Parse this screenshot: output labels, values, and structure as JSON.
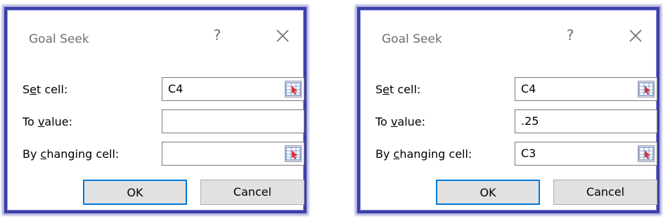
{
  "dialogs": [
    {
      "title": "Goal Seek",
      "help": "?",
      "labels": {
        "set_cell_pre": "S",
        "set_cell_u": "e",
        "set_cell_post": "t cell:",
        "to_value_pre": "To ",
        "to_value_u": "v",
        "to_value_post": "alue:",
        "changing_pre": "By ",
        "changing_u": "c",
        "changing_post": "hanging cell:"
      },
      "set_cell": "C4",
      "to_value": "",
      "changing_cell": "",
      "ok": "OK",
      "cancel": "Cancel"
    },
    {
      "title": "Goal Seek",
      "help": "?",
      "labels": {
        "set_cell_pre": "S",
        "set_cell_u": "e",
        "set_cell_post": "t cell:",
        "to_value_pre": "To ",
        "to_value_u": "v",
        "to_value_post": "alue:",
        "changing_pre": "By ",
        "changing_u": "c",
        "changing_post": "hanging cell:"
      },
      "set_cell": "C4",
      "to_value": ".25",
      "changing_cell": "C3",
      "ok": "OK",
      "cancel": "Cancel"
    }
  ],
  "icons": {
    "close": "close-icon",
    "range_select": "range-select-icon"
  },
  "colors": {
    "frame": "#3b3fa8",
    "default_button_border": "#0078d7",
    "button_bg": "#e1e1e1"
  }
}
